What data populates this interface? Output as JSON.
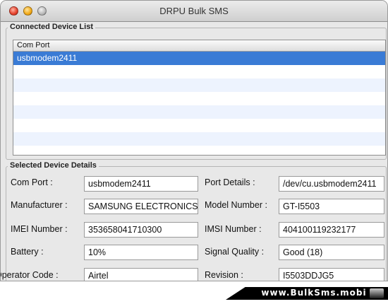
{
  "window": {
    "title": "DRPU Bulk SMS"
  },
  "connected": {
    "legend": "Connected Device List",
    "column_header": "Com Port",
    "rows": [
      "usbmodem2411"
    ]
  },
  "details": {
    "legend": "Selected Device Details",
    "com_port_label": "Com Port :",
    "com_port_value": "usbmodem2411",
    "port_details_label": "Port Details :",
    "port_details_value": "/dev/cu.usbmodem2411",
    "manufacturer_label": "Manufacturer :",
    "manufacturer_value": "SAMSUNG ELECTRONICS",
    "model_label": "Model Number :",
    "model_value": "GT-I5503",
    "imei_label": "IMEI Number :",
    "imei_value": "353658041710300",
    "imsi_label": "IMSI Number :",
    "imsi_value": "404100119232177",
    "battery_label": "Battery :",
    "battery_value": "10%",
    "signal_label": "Signal Quality :",
    "signal_value": "Good (18)",
    "operator_label": "Operator Code :",
    "operator_value": "Airtel",
    "revision_label": "Revision :",
    "revision_value": "I5503DDJG5"
  },
  "banner": {
    "text": "www.BulkSms.mobi"
  },
  "colors": {
    "selection": "#3a7bd5",
    "window_bg": "#e8e8e8"
  }
}
